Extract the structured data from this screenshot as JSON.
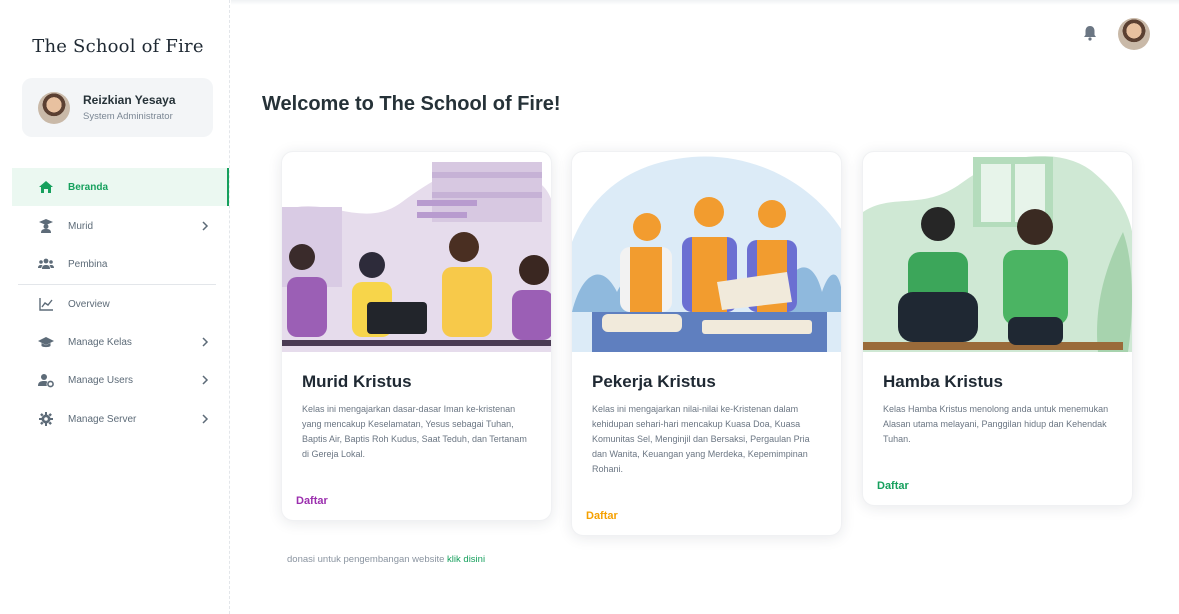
{
  "sidebar": {
    "brand": "The School of Fire",
    "user": {
      "name": "Reizkian Yesaya",
      "role": "System Administrator"
    },
    "items": [
      {
        "label": "Beranda",
        "icon": "home-icon",
        "active": true,
        "has_submenu": false
      },
      {
        "label": "Murid",
        "icon": "student-icon",
        "active": false,
        "has_submenu": true
      },
      {
        "label": "Pembina",
        "icon": "users-group-icon",
        "active": false,
        "has_submenu": false
      },
      {
        "label": "Overview",
        "icon": "chart-line-icon",
        "active": false,
        "has_submenu": false
      },
      {
        "label": "Manage Kelas",
        "icon": "graduation-cap-icon",
        "active": false,
        "has_submenu": true
      },
      {
        "label": "Manage Users",
        "icon": "user-gear-icon",
        "active": false,
        "has_submenu": true
      },
      {
        "label": "Manage Server",
        "icon": "gear-icon",
        "active": false,
        "has_submenu": true
      }
    ]
  },
  "header": {
    "notification_icon": "bell-icon"
  },
  "main": {
    "welcome": "Welcome to The School of Fire!",
    "cards": [
      {
        "title": "Murid Kristus",
        "description": "Kelas ini mengajarkan dasar-dasar Iman ke-kristenan yang mencakup Keselamatan, Yesus sebagai Tuhan, Baptis Air, Baptis Roh Kudus, Saat Teduh, dan Tertanam di Gereja Lokal.",
        "cta": "Daftar",
        "cta_color": "#9b2fae"
      },
      {
        "title": "Pekerja Kristus",
        "description": "Kelas ini mengajarkan nilai-nilai ke-Kristenan dalam kehidupan sehari-hari mencakup Kuasa Doa, Kuasa Komunitas Sel, Menginjil dan Bersaksi, Pergaulan Pria dan Wanita, Keuangan yang Merdeka, Kepemimpinan Rohani.",
        "cta": "Daftar",
        "cta_color": "#f5a000"
      },
      {
        "title": "Hamba Kristus",
        "description": "Kelas Hamba Kristus menolong anda untuk menemukan Alasan utama melayani, Panggilan hidup dan Kehendak Tuhan.",
        "cta": "Daftar",
        "cta_color": "#16a05d"
      }
    ],
    "footer": {
      "text": "donasi untuk pengembangan website",
      "link": "klik disini"
    }
  },
  "colors": {
    "accent": "#16a05d",
    "active_bg": "#ebf8f1",
    "text_dark": "#263238"
  }
}
